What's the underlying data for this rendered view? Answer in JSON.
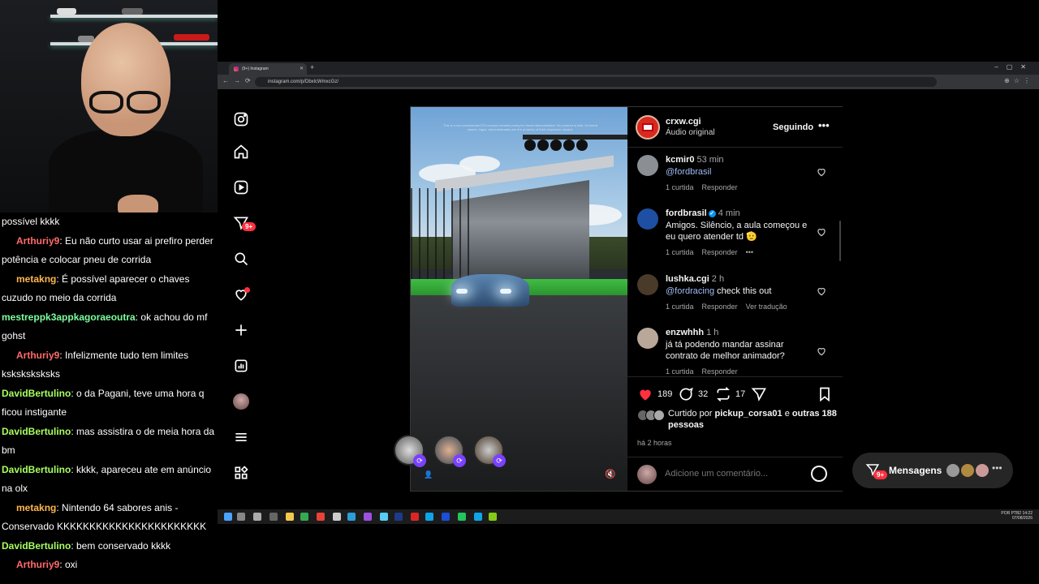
{
  "chat": {
    "messages": [
      {
        "user": "",
        "text": "possível kkkk",
        "color": "#ffffff",
        "indent": false
      },
      {
        "user": "Arthuriy9",
        "text": ": Eu não curto usar ai prefiro perder potência e colocar pneu de corrida",
        "color": "#ff6b6b",
        "indent": true
      },
      {
        "user": "metakng",
        "text": ": É possível aparecer o chaves cuzudo no meio da corrida",
        "color": "#ffb74d",
        "indent": true
      },
      {
        "user": "mestreppk3appkagoraeoutra",
        "text": ": ok achou do mf gohst",
        "color": "#7cff9e",
        "indent": false
      },
      {
        "user": "Arthuriy9",
        "text": ": Infelizmente tudo tem limites ksksksksksks",
        "color": "#ff6b6b",
        "indent": true
      },
      {
        "user": "DavidBertulino",
        "text": ": o da Pagani, teve uma hora q ficou instigante",
        "color": "#a8ff60",
        "indent": false
      },
      {
        "user": "DavidBertulino",
        "text": ": mas assistira o de meia hora da bm",
        "color": "#a8ff60",
        "indent": false
      },
      {
        "user": "DavidBertulino",
        "text": ": kkkk, apareceu ate em anúncio na olx",
        "color": "#a8ff60",
        "indent": false
      },
      {
        "user": "metakng",
        "text": ": Nintendo 64 sabores anis - Conservado KKKKKKKKKKKKKKKKKKKKKKK",
        "color": "#ffb74d",
        "indent": true
      },
      {
        "user": "DavidBertulino",
        "text": ": bem conservado kkkk",
        "color": "#a8ff60",
        "indent": false
      },
      {
        "user": "Arthuriy9",
        "text": ": oxi",
        "color": "#ff6b6b",
        "indent": true
      }
    ]
  },
  "browser": {
    "tab_title": "(9+) Instagram",
    "url": "instagram.com/p/DbxlcWmxcGz/"
  },
  "nav": {
    "notifications_badge": "9+"
  },
  "post": {
    "author": "crxw.cgi",
    "subtitle": "Áudio original",
    "follow_label": "Seguindo",
    "more": "•••",
    "overlay_text": "This is a non-commercial CGI concept created purely for visual demonstration. No product is sold. All brand names, logos, and trademarks are the property of their respective owners.",
    "comments": [
      {
        "user": "kcmir0",
        "time": "53 min",
        "text": "",
        "mention": "@fordbrasil",
        "likes": "1 curtida",
        "reply": "Responder",
        "extra": "",
        "verified": false,
        "avatar": "#8a8f94"
      },
      {
        "user": "fordbrasil",
        "time": "4 min",
        "text": "Amigos. Silêncio, a aula começou e eu quero atender td 🫡",
        "mention": "",
        "likes": "1 curtida",
        "reply": "Responder",
        "extra": "•••",
        "verified": true,
        "avatar": "#1e4fa3"
      },
      {
        "user": "lushka.cgi",
        "time": "2 h",
        "text": " check this out",
        "mention": "@fordracing",
        "likes": "1 curtida",
        "reply": "Responder",
        "extra": "Ver tradução",
        "verified": false,
        "avatar": "#4a3a2a"
      },
      {
        "user": "enzwhhh",
        "time": "1 h",
        "text": "já tá podendo mandar assinar contrato de melhor animador?",
        "mention": "",
        "likes": "1 curtida",
        "reply": "Responder",
        "extra": "",
        "verified": false,
        "avatar": "#b9a79a"
      }
    ],
    "likes_count": "189",
    "comments_count": "32",
    "reposts_count": "17",
    "liked_by_prefix": "Curtido por ",
    "liked_by_user": "pickup_corsa01",
    "liked_by_and": " e ",
    "liked_by_others": "outras 188 pessoas",
    "time_ago": "há 2 horas",
    "comment_placeholder": "Adicione um comentário..."
  },
  "messages_bar": {
    "label": "Mensagens",
    "badge": "9+",
    "more": "•••"
  },
  "taskbar": {
    "lang": "POR PTB2",
    "time": "14:22",
    "date": "07/08/2026"
  },
  "colors": {
    "heart": "#ff3040",
    "mention": "#9fbcf5",
    "badge": "#ff3040"
  }
}
